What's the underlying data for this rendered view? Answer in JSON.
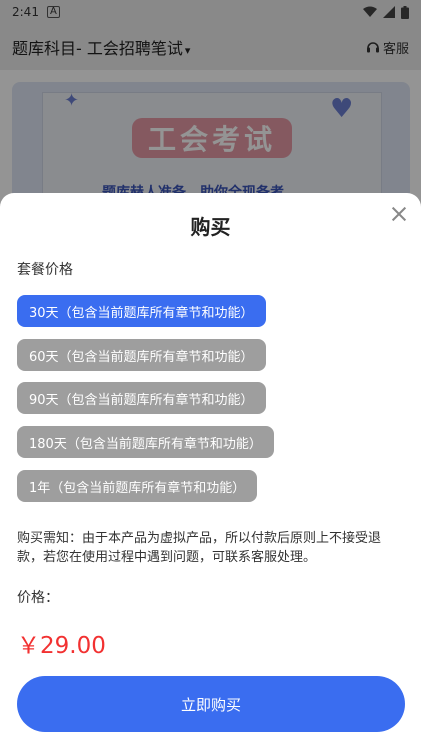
{
  "status_bar": {
    "time": "2:41",
    "notification_glyph": "A"
  },
  "header": {
    "title": "题库科目- 工会招聘笔试",
    "caret": "▾",
    "service_label": "客服"
  },
  "banner": {
    "title": "工会考试",
    "subtitle": "题库赫人准备、助你全现备考"
  },
  "sheet": {
    "title": "购买",
    "section_label": "套餐价格",
    "options": [
      {
        "label": "30天（包含当前题库所有章节和功能）",
        "selected": true
      },
      {
        "label": "60天（包含当前题库所有章节和功能）",
        "selected": false
      },
      {
        "label": "90天（包含当前题库所有章节和功能）",
        "selected": false
      },
      {
        "label": "180天（包含当前题库所有章节和功能）",
        "selected": false
      },
      {
        "label": "1年（包含当前题库所有章节和功能）",
        "selected": false
      }
    ],
    "notice": "购买需知：由于本产品为虚拟产品，所以付款后原则上不接受退款，若您在使用过程中遇到问题，可联系客服处理。",
    "price_label": "价格：",
    "price": "￥29.00",
    "buy_label": "立即购买"
  },
  "colors": {
    "accent": "#3a6df0",
    "price": "#f23131",
    "option_inactive": "#9e9e9e"
  }
}
